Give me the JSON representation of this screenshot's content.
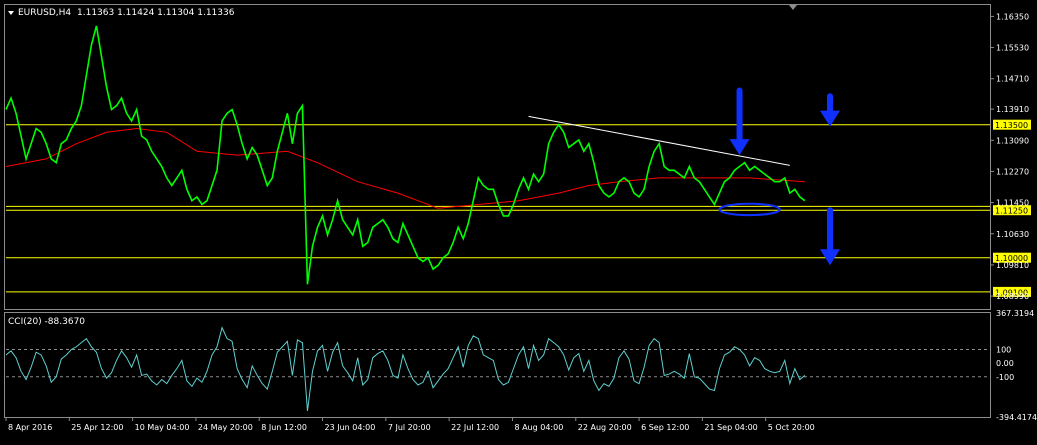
{
  "header": {
    "symbol_label": "EURUSD,H4",
    "ohlc_text": "1.11363 1.11424 1.11304 1.11336"
  },
  "colors": {
    "background": "#000000",
    "price_line": "#00ff00",
    "moving_average": "#ff0000",
    "horizontal_levels": "#ffff00",
    "trendline": "#ffffff",
    "annotations": "#1030ff",
    "cci_line": "#5fd0d0",
    "grid_text": "#ffffff"
  },
  "icons": [
    "down-arrow-icon",
    "ellipse-highlight",
    "collapse-triangle-icon"
  ],
  "chart_data": [
    {
      "type": "line",
      "panel": "main",
      "title": "EURUSD,H4",
      "ylim": [
        1.0865,
        1.1665
      ],
      "y_ticks": [
        "1.16350",
        "1.15530",
        "1.14710",
        "1.13910",
        "1.13090",
        "1.12270",
        "1.11450",
        "1.10630",
        "1.09810",
        "1.08990"
      ],
      "x_ticks": [
        "8 Apr 2016",
        "25 Apr 12:00",
        "10 May 04:00",
        "24 May 20:00",
        "8 Jun 12:00",
        "23 Jun 04:00",
        "7 Jul 20:00",
        "22 Jul 12:00",
        "8 Aug 04:00",
        "22 Aug 20:00",
        "6 Sep 12:00",
        "21 Sep 04:00",
        "5 Oct 20:00"
      ],
      "series": [
        {
          "role": "price",
          "x": [
            0,
            1,
            2,
            3,
            4,
            5,
            6,
            7,
            8,
            9,
            10,
            11,
            12,
            13,
            14,
            15,
            16,
            17,
            18,
            19,
            20,
            21,
            22,
            23,
            24,
            25,
            26,
            27,
            28,
            29,
            30,
            31,
            32,
            33,
            34,
            35,
            36,
            37,
            38,
            39,
            40,
            41,
            42,
            43,
            44,
            45,
            46,
            47,
            48,
            49,
            50,
            51,
            52,
            53,
            54,
            55,
            56,
            57,
            58,
            59,
            60,
            61,
            62,
            63,
            64,
            65,
            66,
            67,
            68,
            69,
            70,
            71,
            72,
            73,
            74,
            75,
            76,
            77,
            78,
            79,
            80,
            81,
            82,
            83,
            84,
            85,
            86,
            87,
            88,
            89,
            90,
            91,
            92,
            93,
            94,
            95,
            96,
            97,
            98,
            99,
            100,
            101,
            102,
            103,
            104,
            105,
            106,
            107,
            108,
            109,
            110,
            111,
            112,
            113,
            114,
            115,
            116,
            117,
            118,
            119,
            120,
            121,
            122,
            123,
            124,
            125,
            126,
            127,
            128,
            129,
            130,
            131,
            132,
            133,
            134,
            135,
            136,
            137,
            138,
            139,
            140,
            141,
            142,
            143,
            144,
            145,
            146,
            147,
            148,
            149,
            150,
            151,
            152,
            153,
            154,
            155,
            156,
            157,
            158,
            159
          ],
          "y": [
            1.139,
            1.142,
            1.138,
            1.132,
            1.126,
            1.13,
            1.134,
            1.133,
            1.13,
            1.126,
            1.125,
            1.13,
            1.131,
            1.134,
            1.136,
            1.14,
            1.148,
            1.156,
            1.161,
            1.153,
            1.145,
            1.139,
            1.14,
            1.142,
            1.138,
            1.136,
            1.139,
            1.132,
            1.131,
            1.128,
            1.126,
            1.124,
            1.121,
            1.119,
            1.121,
            1.123,
            1.118,
            1.115,
            1.116,
            1.114,
            1.115,
            1.119,
            1.123,
            1.136,
            1.138,
            1.139,
            1.135,
            1.13,
            1.126,
            1.129,
            1.127,
            1.123,
            1.119,
            1.121,
            1.128,
            1.133,
            1.138,
            1.13,
            1.138,
            1.14,
            1.093,
            1.103,
            1.108,
            1.111,
            1.106,
            1.11,
            1.115,
            1.11,
            1.108,
            1.106,
            1.11,
            1.103,
            1.104,
            1.108,
            1.109,
            1.11,
            1.108,
            1.105,
            1.104,
            1.109,
            1.106,
            1.103,
            1.1,
            1.099,
            1.1,
            1.097,
            1.098,
            1.1,
            1.101,
            1.104,
            1.108,
            1.105,
            1.109,
            1.115,
            1.121,
            1.119,
            1.118,
            1.118,
            1.114,
            1.111,
            1.111,
            1.114,
            1.118,
            1.121,
            1.118,
            1.122,
            1.12,
            1.122,
            1.13,
            1.133,
            1.135,
            1.133,
            1.129,
            1.13,
            1.131,
            1.128,
            1.13,
            1.125,
            1.119,
            1.117,
            1.116,
            1.117,
            1.12,
            1.121,
            1.12,
            1.117,
            1.116,
            1.118,
            1.124,
            1.128,
            1.13,
            1.124,
            1.123,
            1.123,
            1.122,
            1.121,
            1.124,
            1.121,
            1.12,
            1.118,
            1.116,
            1.114,
            1.117,
            1.12,
            1.121,
            1.123,
            1.124,
            1.125,
            1.123,
            1.124,
            1.123,
            1.122,
            1.121,
            1.12,
            1.12,
            1.121,
            1.117,
            1.118,
            1.116,
            1.115
          ]
        },
        {
          "role": "moving_average",
          "x": [
            0,
            8,
            14,
            20,
            26,
            32,
            38,
            46,
            56,
            62,
            70,
            78,
            86,
            94,
            102,
            110,
            116,
            122,
            130,
            140,
            148,
            159
          ],
          "y": [
            1.124,
            1.126,
            1.13,
            1.133,
            1.134,
            1.133,
            1.128,
            1.127,
            1.128,
            1.125,
            1.12,
            1.117,
            1.113,
            1.114,
            1.115,
            1.117,
            1.119,
            1.12,
            1.121,
            1.121,
            1.121,
            1.12
          ]
        }
      ],
      "horizontal_levels": [
        {
          "value": 1.135,
          "label": "1.13500"
        },
        {
          "value": 1.1125,
          "label": "1.11250"
        },
        {
          "value": 1.1,
          "label": "1.10000"
        },
        {
          "value": 1.091,
          "label": "1.09100"
        }
      ],
      "level_extra": {
        "value": 1.1135
      },
      "trendline": {
        "x": [
          104,
          156
        ],
        "y": [
          1.1372,
          1.1243
        ]
      },
      "annotations": [
        {
          "type": "arrow-down",
          "x": 146,
          "y_top": 1.144,
          "y_bottom": 1.127
        },
        {
          "type": "arrow-down",
          "x": 164,
          "y_top": 1.1425,
          "y_bottom": 1.1345
        },
        {
          "type": "arrow-down",
          "x": 164,
          "y_top": 1.1125,
          "y_bottom": 1.098
        },
        {
          "type": "ellipse",
          "x": 148,
          "y": 1.1127,
          "rx_units": 6,
          "ry_units": 0.0015
        }
      ]
    },
    {
      "type": "line",
      "panel": "indicator",
      "title": "CCI(20) -88.3670",
      "ylim": [
        -394.4174,
        367.3194
      ],
      "y_ticks": [
        {
          "value": 367.3194,
          "label": "367.3194"
        },
        {
          "value": 100,
          "label": "100"
        },
        {
          "value": 0,
          "label": "0.00"
        },
        {
          "value": -100,
          "label": "-100"
        },
        {
          "value": -394.4174,
          "label": "-394.4174"
        }
      ],
      "levels": [
        100,
        -100
      ],
      "series": [
        {
          "role": "cci",
          "x": [
            0,
            1,
            2,
            3,
            4,
            5,
            6,
            7,
            8,
            9,
            10,
            11,
            12,
            13,
            14,
            15,
            16,
            17,
            18,
            19,
            20,
            21,
            22,
            23,
            24,
            25,
            26,
            27,
            28,
            29,
            30,
            31,
            32,
            33,
            34,
            35,
            36,
            37,
            38,
            39,
            40,
            41,
            42,
            43,
            44,
            45,
            46,
            47,
            48,
            49,
            50,
            51,
            52,
            53,
            54,
            55,
            56,
            57,
            58,
            59,
            60,
            61,
            62,
            63,
            64,
            65,
            66,
            67,
            68,
            69,
            70,
            71,
            72,
            73,
            74,
            75,
            76,
            77,
            78,
            79,
            80,
            81,
            82,
            83,
            84,
            85,
            86,
            87,
            88,
            89,
            90,
            91,
            92,
            93,
            94,
            95,
            96,
            97,
            98,
            99,
            100,
            101,
            102,
            103,
            104,
            105,
            106,
            107,
            108,
            109,
            110,
            111,
            112,
            113,
            114,
            115,
            116,
            117,
            118,
            119,
            120,
            121,
            122,
            123,
            124,
            125,
            126,
            127,
            128,
            129,
            130,
            131,
            132,
            133,
            134,
            135,
            136,
            137,
            138,
            139,
            140,
            141,
            142,
            143,
            144,
            145,
            146,
            147,
            148,
            149,
            150,
            151,
            152,
            153,
            154,
            155,
            156,
            157,
            158,
            159
          ],
          "y": [
            60,
            90,
            40,
            -60,
            -120,
            -30,
            80,
            60,
            -20,
            -140,
            -100,
            30,
            60,
            100,
            120,
            150,
            180,
            120,
            80,
            -40,
            -110,
            -70,
            20,
            90,
            40,
            -30,
            60,
            -90,
            -80,
            -130,
            -160,
            -120,
            -150,
            -90,
            -40,
            20,
            -130,
            -170,
            -110,
            -140,
            -60,
            60,
            120,
            260,
            180,
            160,
            -40,
            -120,
            -180,
            -20,
            -90,
            -150,
            -190,
            -60,
            80,
            120,
            160,
            -90,
            170,
            150,
            -350,
            -60,
            90,
            130,
            -60,
            80,
            150,
            -20,
            -70,
            -130,
            40,
            -160,
            -120,
            40,
            70,
            90,
            20,
            -90,
            -110,
            60,
            -40,
            -120,
            -160,
            -140,
            -60,
            -180,
            -130,
            -80,
            -40,
            40,
            120,
            -30,
            130,
            200,
            180,
            60,
            40,
            20,
            -120,
            -160,
            -140,
            -40,
            60,
            120,
            -40,
            130,
            20,
            60,
            180,
            150,
            120,
            60,
            -50,
            40,
            70,
            -60,
            20,
            -130,
            -200,
            -150,
            -170,
            -110,
            40,
            90,
            30,
            -130,
            -150,
            -30,
            130,
            180,
            150,
            -90,
            -80,
            -60,
            -80,
            -110,
            70,
            -100,
            -110,
            -150,
            -190,
            -200,
            -40,
            60,
            80,
            120,
            100,
            60,
            -20,
            40,
            20,
            -40,
            -60,
            -70,
            -60,
            20,
            -150,
            -40,
            -120,
            -90
          ]
        }
      ]
    }
  ]
}
